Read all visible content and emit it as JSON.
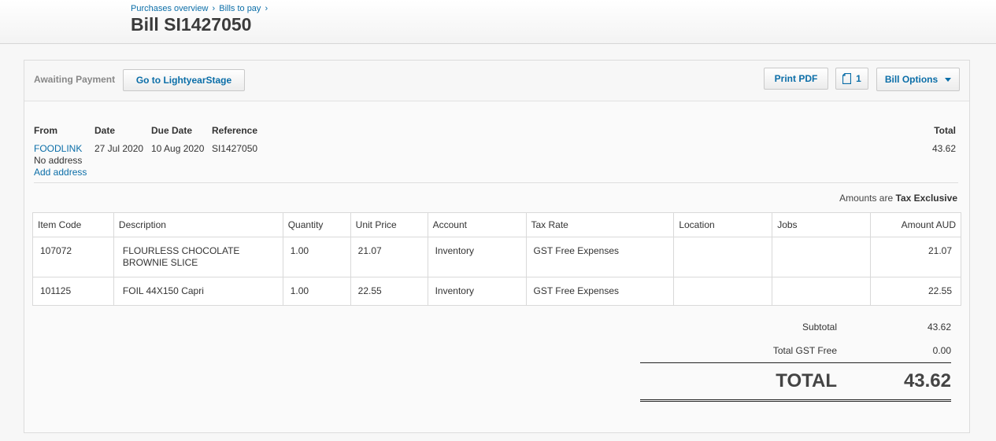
{
  "breadcrumb": {
    "items": [
      "Purchases overview",
      "Bills to pay"
    ],
    "separator": "›"
  },
  "page": {
    "title": "Bill SI1427050"
  },
  "toolbar": {
    "status": "Awaiting Payment",
    "goto_label": "Go to LightyearStage",
    "print_label": "Print PDF",
    "files_count": "1",
    "files_icon": "document-icon",
    "options_label": "Bill Options",
    "options_icon": "chevron-down-icon"
  },
  "bill": {
    "from_label": "From",
    "from_value": "FOODLINK",
    "no_address": "No address",
    "add_address": "Add address",
    "date_label": "Date",
    "date_value": "27 Jul 2020",
    "due_label": "Due Date",
    "due_value": "10 Aug 2020",
    "ref_label": "Reference",
    "ref_value": "SI1427050",
    "total_label": "Total",
    "total_value": "43.62"
  },
  "tax_note": {
    "prefix": "Amounts are",
    "mode": "Tax Exclusive"
  },
  "table": {
    "columns": [
      "Item Code",
      "Description",
      "Quantity",
      "Unit Price",
      "Account",
      "Tax Rate",
      "Location",
      "Jobs",
      "Amount AUD"
    ],
    "rows": [
      {
        "code": "107072",
        "description": "FLOURLESS CHOCOLATE BROWNIE SLICE",
        "quantity": "1.00",
        "unit_price": "21.07",
        "account": "Inventory",
        "tax_rate": "GST Free Expenses",
        "location": "",
        "jobs": "",
        "amount": "21.07"
      },
      {
        "code": "101125",
        "description": "FOIL 44X150 Capri",
        "quantity": "1.00",
        "unit_price": "22.55",
        "account": "Inventory",
        "tax_rate": "GST Free Expenses",
        "location": "",
        "jobs": "",
        "amount": "22.55"
      }
    ]
  },
  "totals": {
    "subtotal_label": "Subtotal",
    "subtotal_value": "43.62",
    "gst_label": "Total GST Free",
    "gst_value": "0.00",
    "total_label": "TOTAL",
    "total_value": "43.62"
  },
  "colors": {
    "link": "#0b6ea8",
    "text": "#333333",
    "status": "#888888"
  }
}
